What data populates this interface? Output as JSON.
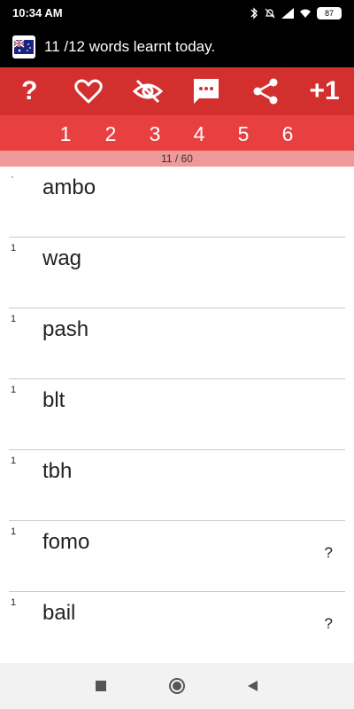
{
  "status": {
    "time": "10:34 AM",
    "battery": "87"
  },
  "header": {
    "title": "11 /12 words learnt today."
  },
  "toolbar": {
    "help_label": "?",
    "plus_label": "+1"
  },
  "pages": [
    "1",
    "2",
    "3",
    "4",
    "5",
    "6"
  ],
  "progress": "11 / 60",
  "words": [
    {
      "count": "·",
      "word": "ambo",
      "help": ""
    },
    {
      "count": "1",
      "word": "wag",
      "help": ""
    },
    {
      "count": "1",
      "word": "pash",
      "help": ""
    },
    {
      "count": "1",
      "word": "blt",
      "help": ""
    },
    {
      "count": "1",
      "word": "tbh",
      "help": ""
    },
    {
      "count": "1",
      "word": "fomo",
      "help": "?"
    },
    {
      "count": "1",
      "word": "bail",
      "help": "?"
    }
  ],
  "colors": {
    "toolbar": "#d32f2f",
    "pages": "#e84040",
    "progress": "#ef9a9a"
  }
}
